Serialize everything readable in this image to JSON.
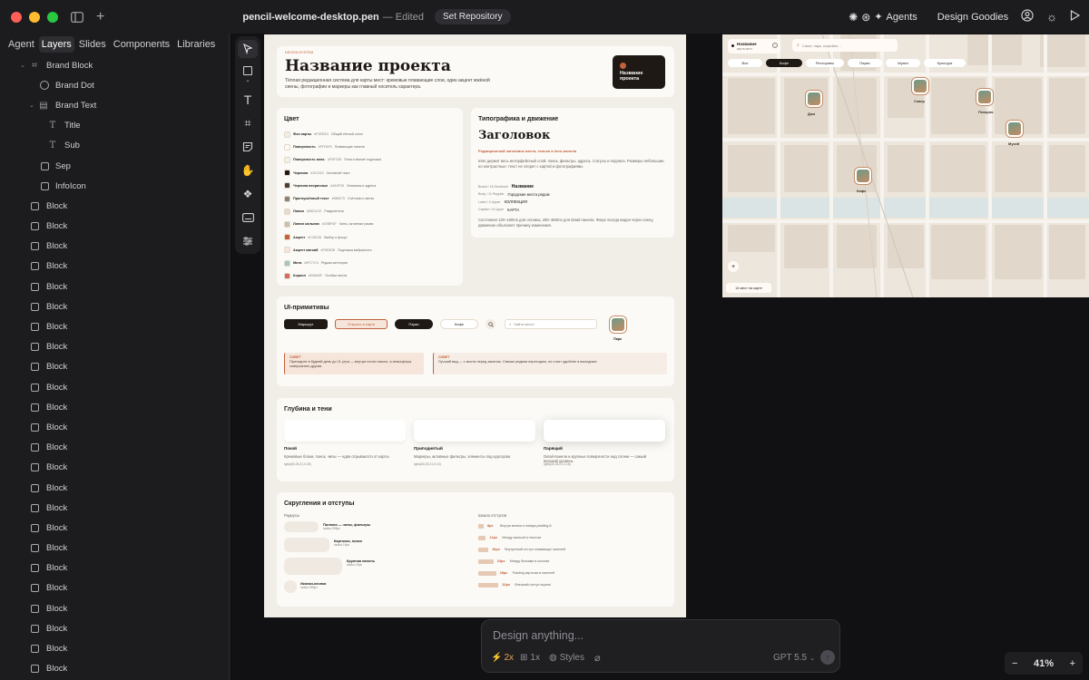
{
  "titlebar": {
    "doc_title": "pencil-welcome-desktop.pen",
    "doc_status": "— Edited",
    "set_repo": "Set Repository",
    "agents": "Agents",
    "design_goodies": "Design Goodies"
  },
  "left_tabs": [
    "Agent",
    "Layers",
    "Slides",
    "Components",
    "Libraries"
  ],
  "layers": [
    {
      "name": "Brand Block",
      "icon": "frame-icon"
    },
    {
      "name": "Brand Dot",
      "icon": "ellipse-icon"
    },
    {
      "name": "Brand Text",
      "icon": "stack-icon"
    },
    {
      "name": "Title",
      "icon": "text-icon"
    },
    {
      "name": "Sub",
      "icon": "text-icon"
    },
    {
      "name": "Sep",
      "icon": "rectangle-icon"
    },
    {
      "name": "InfoIcon",
      "icon": "rectangle-icon"
    },
    {
      "name": "Block"
    },
    {
      "name": "Block"
    },
    {
      "name": "Block"
    },
    {
      "name": "Block"
    },
    {
      "name": "Block"
    },
    {
      "name": "Block"
    },
    {
      "name": "Block"
    },
    {
      "name": "Block"
    },
    {
      "name": "Block"
    },
    {
      "name": "Block"
    },
    {
      "name": "Block"
    },
    {
      "name": "Block"
    },
    {
      "name": "Block"
    },
    {
      "name": "Block"
    },
    {
      "name": "Block"
    },
    {
      "name": "Block"
    },
    {
      "name": "Block"
    },
    {
      "name": "Block"
    },
    {
      "name": "Block"
    },
    {
      "name": "Block"
    },
    {
      "name": "Block"
    },
    {
      "name": "Block"
    },
    {
      "name": "Block"
    },
    {
      "name": "Block"
    }
  ],
  "board": {
    "eyebrow": "DESIGN SYSTEM",
    "title": "Название проекта",
    "desc": "Тёплая редакционная система для карты мест: кремовые плавающие слои, один акцент жжёной сиены, фотографии и маркеры как главный носитель характера.",
    "badge": "Название проекта",
    "color_h": "Цвет",
    "colors": [
      {
        "name": "Фон карты",
        "hex": "#F3EDE4",
        "desc": "Общий тёплый холст",
        "c": "#f3ede4"
      },
      {
        "name": "Поверхность",
        "hex": "#FFFAF6",
        "desc": "Плавающие панели",
        "c": "#fffaf6"
      },
      {
        "name": "Поверхность мягк.",
        "hex": "#F8F1E8",
        "desc": "Поля и мягкие подложки",
        "c": "#f8f1e8"
      },
      {
        "name": "Чернила",
        "hex": "#1E1915",
        "desc": "Основной текст",
        "c": "#1e1915"
      },
      {
        "name": "Чернила вторичные",
        "hex": "#4A3F35",
        "desc": "Описания и адреса",
        "c": "#4a3f35"
      },
      {
        "name": "Приглушённый текст",
        "hex": "#8B8275",
        "desc": "Счётчики и метки",
        "c": "#8b8275"
      },
      {
        "name": "Линия",
        "hex": "#E6DCCE",
        "desc": "Разделители",
        "c": "#e6dcce"
      },
      {
        "name": "Линия сильная",
        "hex": "#CBBFAF",
        "desc": "Чипы, активные рамки",
        "c": "#cbbfaf"
      },
      {
        "name": "Акцент",
        "hex": "#C2613A",
        "desc": "Выбор и фокус",
        "c": "#c2613a"
      },
      {
        "name": "Акцент мягкий",
        "hex": "#F6E5DB",
        "desc": "Подложка выбранного",
        "c": "#f6e5db"
      },
      {
        "name": "Мята",
        "hex": "#9FC7C4",
        "desc": "Редкая категория",
        "c": "#9fc7c4"
      },
      {
        "name": "Коралл",
        "hex": "#D56A5F",
        "desc": "Особые места",
        "c": "#d56a5f"
      }
    ],
    "typo_h": "Типографика и движение",
    "typo_title": "Заголовок",
    "typo_accent": "Редакционный заголовок места, только в hero-панели",
    "typo_desc": "Inter держит весь интерфейсный слой: поиск, фильтры, адреса, статусы и подписи. Размеры небольшие, но контрастные; текст не спорит с картой и фотографиями.",
    "typo_rows": [
      {
        "k": "Brand / 18 Semibold",
        "v": "Название"
      },
      {
        "k": "Body / 11 Regular",
        "v": "Городские места рядом"
      },
      {
        "k": "Label / 9 Upper",
        "v": "КОЛЛЕКЦИЯ"
      },
      {
        "k": "Caption / 8 Upper",
        "v": "КАРТА"
      }
    ],
    "typo_motion": "Состояния 120–180ms для отклика, 260–360ms для detail-панели. Фокус всегда виден через сиену, движение объясняет причину изменения.",
    "ui_h": "UI-примитивы",
    "ui_btn1": "Маршрут",
    "ui_btn2": "Открыть в карте",
    "ui_chip1": "Парки",
    "ui_chip2": "Кофе",
    "ui_search": "Найти место",
    "ui_pin": "Парк",
    "ui_tip1_h": "СОВЕТ",
    "ui_tip1": "Приходите в будний день до 11 утра — внутри почти никого, а атмосфера совершенно другая.",
    "ui_tip2_h": "СОВЕТ",
    "ui_tip2": "Лучший вид — с моста перед закатом. Связан редким переходом, но стоит удобнее в выходные.",
    "depth_h": "Глубина и тени",
    "depth": [
      {
        "t": "Покой",
        "d": "Кремовые блоки, поиск, чипы — едва отрываются от карты",
        "s": "rgba(30,25,21,0.05)"
      },
      {
        "t": "Приподнятый",
        "d": "Маркеры, активные фильтры, элементы под курсором",
        "s": "rgba(30,25,21,0.10)"
      },
      {
        "t": "Парящий",
        "d": "Detail-панели и крупные поверхности над слоем — самый верхний уровень",
        "s": "rgba(30,25,21,0.18)"
      }
    ],
    "radii_h": "Скругления и отступы",
    "radii_label": "Радиусы",
    "radii": [
      {
        "t": "Пилюля — чипы, фильтры",
        "s": "radius 999px"
      },
      {
        "t": "Карточки, поиск",
        "s": "radius 16px"
      },
      {
        "t": "Крупная панель",
        "s": "radius 20px"
      },
      {
        "t": "Иконки-кнопки",
        "s": "radius 999px"
      }
    ],
    "spacing_label": "Шкала отступов",
    "spacing": [
      {
        "v": "8px",
        "d": "Внутри кнопки и malaya padding-й"
      },
      {
        "v": "12px",
        "d": "Между иконкой и текстом"
      },
      {
        "v": "16px",
        "d": "Внутренний отступ плавающих панелей"
      },
      {
        "v": "24px",
        "d": "Между блоками в колонке"
      },
      {
        "v": "28px",
        "d": "Padding карточки в панелей"
      },
      {
        "v": "32px",
        "d": "Внешний отступ экрана"
      }
    ]
  },
  "map": {
    "brand": "Название",
    "brand_sub": "карта мест",
    "search": "Санкт, парк, кофейня…",
    "chips": [
      "Все",
      "Кофе",
      "Рестораны",
      "Парки",
      "Музеи",
      "Культура"
    ],
    "pins": [
      "Дом",
      "Сквер",
      "Пекарня",
      "Музей",
      "Кафе"
    ],
    "count": "14 мест на карте",
    "zoom_in": "+"
  },
  "prompt": {
    "placeholder": "Design anything...",
    "speed": "2x",
    "grid": "1x",
    "styles": "Styles",
    "model": "GPT 5.5"
  },
  "zoom": {
    "value": "41%",
    "minus": "−",
    "plus": "+"
  }
}
